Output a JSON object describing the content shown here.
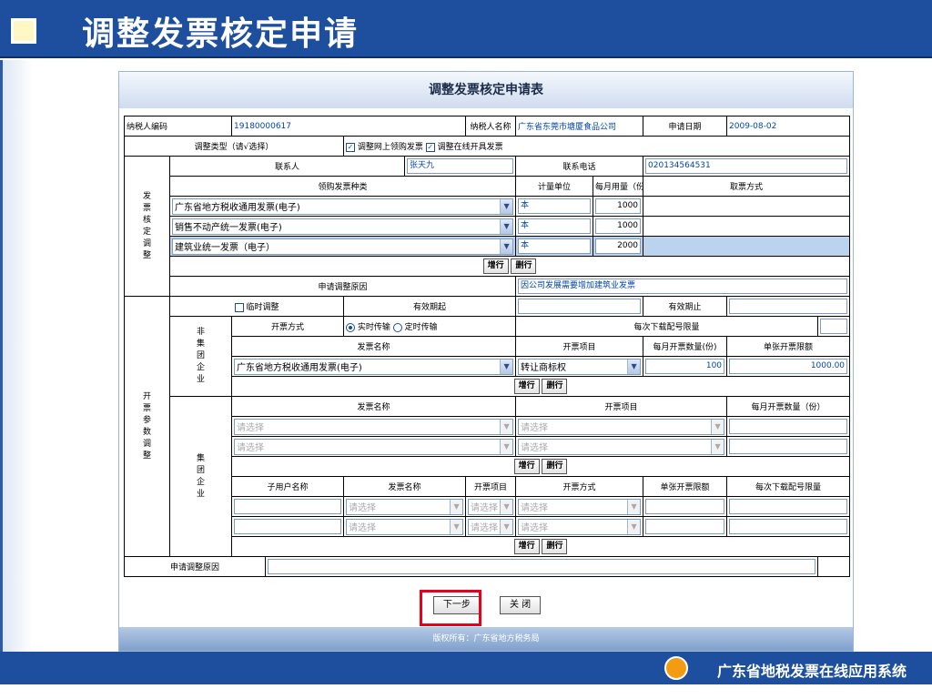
{
  "slide": {
    "title": "调整发票核定申请",
    "footer_system": "广东省地税发票在线应用系统"
  },
  "window": {
    "title": "调整发票核定申请表",
    "copyright": "版权所有：广东省地方税务局"
  },
  "header_row": {
    "taxpayer_code_label": "纳税人编码",
    "taxpayer_code": "19180000617",
    "taxpayer_name_label": "纳税人名称",
    "taxpayer_name": "广东省东莞市塘厦食品公司",
    "apply_date_label": "申请日期",
    "apply_date": "2009-08-02"
  },
  "adjust_type": {
    "label": "调整类型（请√选择）",
    "opt1": "调整网上领购发票",
    "opt2": "调整在线开具发票"
  },
  "invoice_section": {
    "side_label": "发票核定调整",
    "contact_label": "联系人",
    "contact": "张天九",
    "phone_label": "联系电话",
    "phone": "020134564531",
    "col_type": "领购发票种类",
    "col_unit": "计量单位",
    "col_monthly": "每月用量（份/本）",
    "col_pickup": "取票方式",
    "rows": [
      {
        "type": "广东省地方税收通用发票(电子)",
        "unit": "本",
        "qty": "1000"
      },
      {
        "type": "销售不动产统一发票(电子)",
        "unit": "本",
        "qty": "1000"
      },
      {
        "type": "建筑业统一发票（电子）",
        "unit": "本",
        "qty": "2000"
      }
    ],
    "add_row": "增行",
    "del_row": "删行",
    "reason_label": "申请调整原因",
    "reason": "因公司发展需要增加建筑业发票"
  },
  "param_section": {
    "side_label": "开票参数调整",
    "temp_label": "临时调整",
    "valid_from_label": "有效期起",
    "valid_to_label": "有效期止",
    "non_group_label": "非集团企业",
    "issue_mode_label": "开票方式",
    "mode_realtime": "实时传输",
    "mode_timed": "定时传输",
    "download_limit_label": "每次下载配号限量",
    "col_invoice_name": "发票名称",
    "col_item": "开票项目",
    "col_monthly_count": "每月开票数量(份)",
    "col_single_limit": "单张开票限额",
    "non_group_row": {
      "invoice": "广东省地方税收通用发票(电子)",
      "item": "转让商标权",
      "count": "100",
      "limit": "1000.00"
    },
    "group_label": "集团企业",
    "group_col_invoice": "发票名称",
    "group_col_item": "开票项目",
    "group_col_monthly": "每月开票数量（份）",
    "placeholder": "请选择",
    "sub_col_user": "子用户名称",
    "sub_col_invoice": "发票名称",
    "sub_col_item": "开票项目",
    "sub_col_mode": "开票方式",
    "sub_col_limit": "单张开票限额",
    "sub_col_download": "每次下载配号限量",
    "add_row": "增行",
    "del_row": "删行"
  },
  "bottom": {
    "reason_label": "申请调整原因",
    "next": "下一步",
    "close": "关 闭"
  }
}
